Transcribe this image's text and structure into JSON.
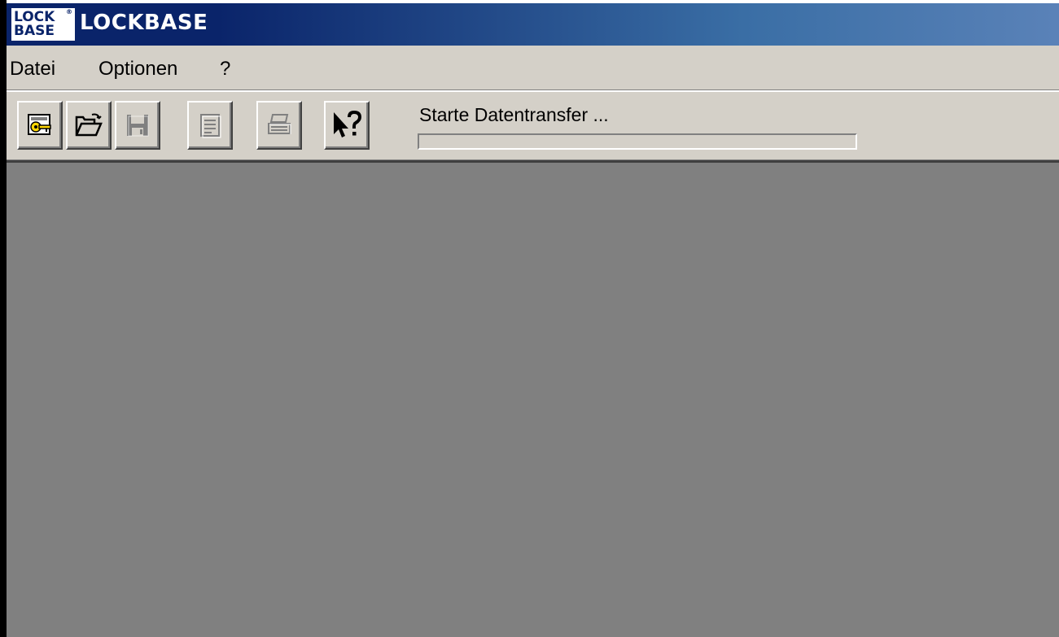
{
  "window": {
    "title": "LOCKBASE",
    "logo": {
      "line1": "LOCK",
      "line2": "BASE",
      "registered": "®"
    },
    "title_gradient_colors": [
      "#0a246a",
      "#5a82b8"
    ]
  },
  "menu": {
    "items": [
      {
        "label": "Datei"
      },
      {
        "label": "Optionen"
      },
      {
        "label": "?"
      }
    ]
  },
  "toolbar": {
    "buttons": [
      {
        "icon": "key-card-icon",
        "enabled": true
      },
      {
        "icon": "open-folder-icon",
        "enabled": true
      },
      {
        "icon": "save-disk-icon",
        "enabled": false
      },
      {
        "icon": "document-list-icon",
        "enabled": false
      },
      {
        "icon": "print-icon",
        "enabled": false
      },
      {
        "icon": "context-help-icon",
        "enabled": true
      }
    ],
    "status_text": "Starte Datentransfer ...",
    "progress": 0
  },
  "colors": {
    "face": "#d4d0c8",
    "client_area": "#808080"
  }
}
